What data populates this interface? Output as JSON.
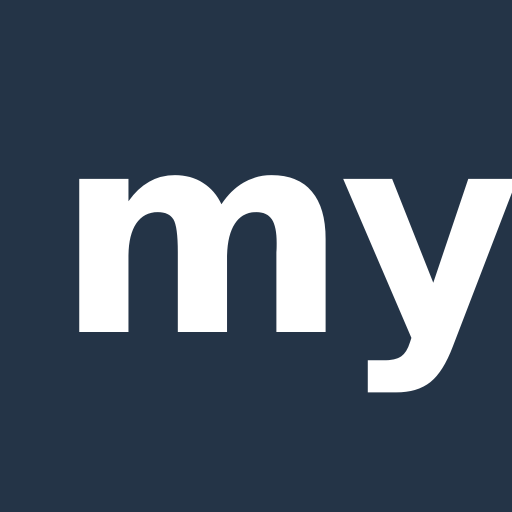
{
  "app_icon": {
    "logo_text": "my"
  },
  "colors": {
    "background": "#243447",
    "text": "#ffffff"
  }
}
